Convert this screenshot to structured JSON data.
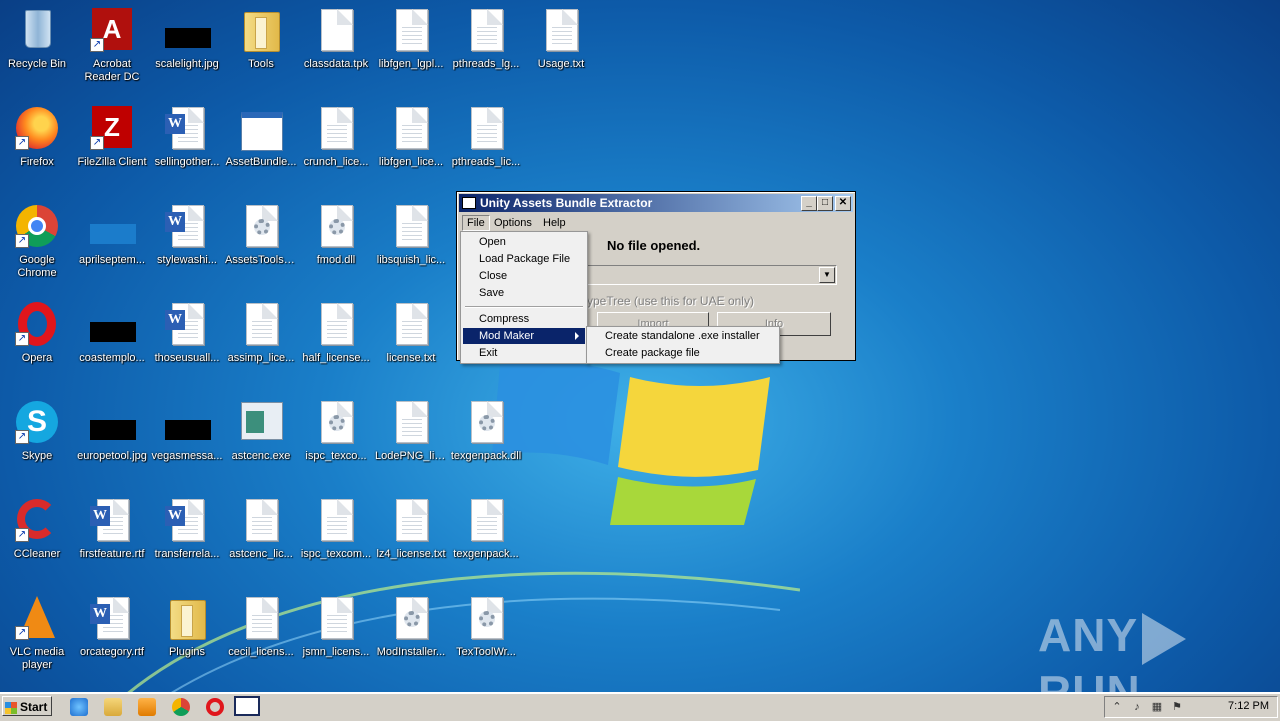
{
  "desktop": {
    "icons": [
      {
        "label": "Recycle Bin"
      },
      {
        "label": "Acrobat Reader DC"
      },
      {
        "label": "scalelight.jpg"
      },
      {
        "label": "Tools"
      },
      {
        "label": "classdata.tpk"
      },
      {
        "label": "libfgen_lgpl..."
      },
      {
        "label": "pthreads_lg..."
      },
      {
        "label": "Usage.txt"
      },
      {
        "label": "Firefox"
      },
      {
        "label": "FileZilla Client"
      },
      {
        "label": "sellingother..."
      },
      {
        "label": "AssetBundle..."
      },
      {
        "label": "crunch_lice..."
      },
      {
        "label": "libfgen_lice..."
      },
      {
        "label": "pthreads_lic..."
      },
      {
        "label": "Google Chrome"
      },
      {
        "label": "aprilseptem..."
      },
      {
        "label": "stylewashi..."
      },
      {
        "label": "AssetsTools.dll"
      },
      {
        "label": "fmod.dll"
      },
      {
        "label": "libsquish_lic..."
      },
      {
        "label": "Opera"
      },
      {
        "label": "coastemplo..."
      },
      {
        "label": "thoseusuall..."
      },
      {
        "label": "assimp_lice..."
      },
      {
        "label": "half_license..."
      },
      {
        "label": "license.txt"
      },
      {
        "label": "Skype"
      },
      {
        "label": "europetool.jpg"
      },
      {
        "label": "vegasmessa..."
      },
      {
        "label": "astcenc.exe"
      },
      {
        "label": "ispc_texco..."
      },
      {
        "label": "LodePNG_lic..."
      },
      {
        "label": "texgenpack.dll"
      },
      {
        "label": "CCleaner"
      },
      {
        "label": "firstfeature.rtf"
      },
      {
        "label": "transferrela..."
      },
      {
        "label": "astcenc_lic..."
      },
      {
        "label": "ispc_texcom..."
      },
      {
        "label": "lz4_license.txt"
      },
      {
        "label": "texgenpack..."
      },
      {
        "label": "VLC media player"
      },
      {
        "label": "orcategory.rtf"
      },
      {
        "label": "Plugins"
      },
      {
        "label": "cecil_licens..."
      },
      {
        "label": "jsmn_licens..."
      },
      {
        "label": "ModInstaller..."
      },
      {
        "label": "TexToolWr..."
      }
    ]
  },
  "dialog": {
    "title": "Unity Assets Bundle Extractor",
    "menubar": [
      "File",
      "Options",
      "Help"
    ],
    "status": "No file opened.",
    "typetree_text": "ypeTree (use this for UAE only)",
    "buttons": [
      "Import",
      "Info"
    ]
  },
  "file_menu": {
    "items": [
      "Open",
      "Load Package File",
      "Close",
      "Save",
      "Compress",
      "Mod Maker",
      "Exit"
    ],
    "highlighted": "Mod Maker"
  },
  "mod_maker_submenu": {
    "items": [
      "Create standalone .exe installer",
      "Create package file"
    ]
  },
  "taskbar": {
    "start_label": "Start",
    "clock": "7:12 PM"
  },
  "watermark": {
    "left": "ANY",
    "right": "RUN"
  },
  "colors": {
    "titlebar_start": "#0a246a",
    "titlebar_end": "#a6caf0",
    "menu_highlight": "#0a246a",
    "dialog_face": "#d4d0c8"
  }
}
